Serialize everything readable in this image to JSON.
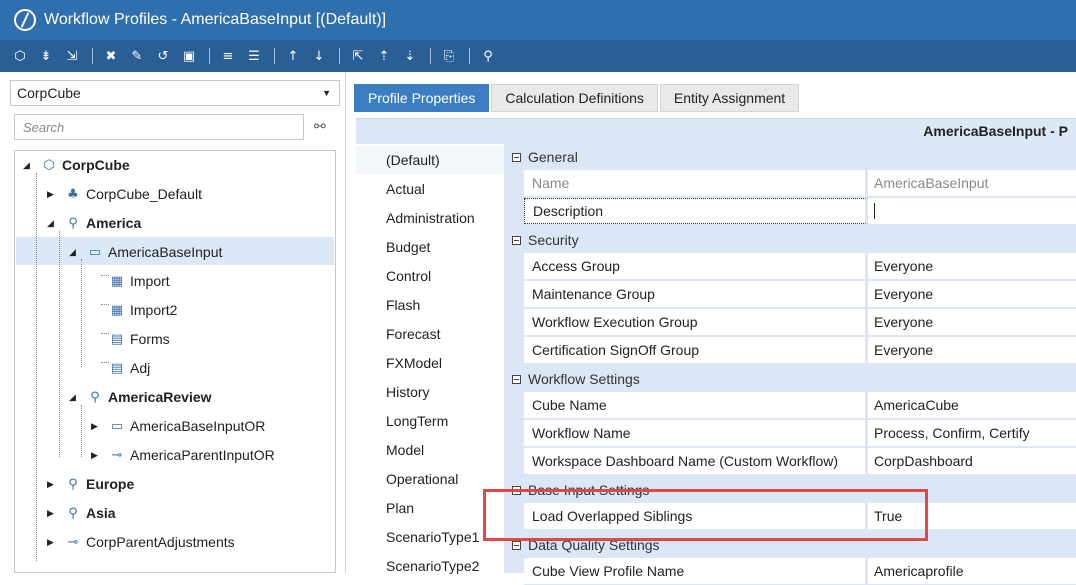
{
  "window": {
    "title": "Workflow Profiles - AmericaBaseInput [(Default)]"
  },
  "toolbar": {
    "icons": [
      "cube-icon",
      "add-sibling-icon",
      "add-child-icon",
      "delete-icon",
      "edit-icon",
      "refresh-icon",
      "save-icon",
      "collapse-icon",
      "expand-icon",
      "move-up-icon",
      "move-down-icon",
      "promote-icon",
      "add-up-icon",
      "demote-icon",
      "copy-icon",
      "search-icon"
    ]
  },
  "left": {
    "cube_select": "CorpCube",
    "search_placeholder": "Search",
    "tree": [
      {
        "label": "CorpCube",
        "bold": true
      },
      {
        "label": "CorpCube_Default",
        "bold": false
      },
      {
        "label": "America",
        "bold": true
      },
      {
        "label": "AmericaBaseInput",
        "bold": false
      },
      {
        "label": "Import",
        "bold": false
      },
      {
        "label": "Import2",
        "bold": false
      },
      {
        "label": "Forms",
        "bold": false
      },
      {
        "label": "Adj",
        "bold": false
      },
      {
        "label": "AmericaReview",
        "bold": true
      },
      {
        "label": "AmericaBaseInputOR",
        "bold": false
      },
      {
        "label": "AmericaParentInputOR",
        "bold": false
      },
      {
        "label": "Europe",
        "bold": true
      },
      {
        "label": "Asia",
        "bold": true
      },
      {
        "label": "CorpParentAdjustments",
        "bold": false
      }
    ]
  },
  "tabs": [
    "Profile Properties",
    "Calculation Definitions",
    "Entity Assignment"
  ],
  "header": {
    "title": "AmericaBaseInput - P"
  },
  "scenario_types": [
    "(Default)",
    "Actual",
    "Administration",
    "Budget",
    "Control",
    "Flash",
    "Forecast",
    "FXModel",
    "History",
    "LongTerm",
    "Model",
    "Operational",
    "Plan",
    "ScenarioType1",
    "ScenarioType2"
  ],
  "properties": {
    "general": {
      "title": "General",
      "name_label": "Name",
      "name_value": "AmericaBaseInput",
      "description_label": "Description"
    },
    "security": {
      "title": "Security",
      "rows": [
        {
          "k": "Access Group",
          "v": "Everyone"
        },
        {
          "k": "Maintenance Group",
          "v": "Everyone"
        },
        {
          "k": "Workflow Execution Group",
          "v": "Everyone"
        },
        {
          "k": "Certification SignOff Group",
          "v": "Everyone"
        }
      ]
    },
    "workflow": {
      "title": "Workflow Settings",
      "rows": [
        {
          "k": "Cube Name",
          "v": "AmericaCube"
        },
        {
          "k": "Workflow Name",
          "v": "Process, Confirm, Certify"
        },
        {
          "k": "Workspace Dashboard Name (Custom Workflow)",
          "v": "CorpDashboard"
        }
      ]
    },
    "base_input": {
      "title": "Base Input Settings",
      "rows": [
        {
          "k": "Load Overlapped Siblings",
          "v": "True"
        }
      ]
    },
    "data_quality": {
      "title": "Data Quality Settings",
      "rows": [
        {
          "k": "Cube View Profile Name",
          "v": "Americaprofile"
        }
      ]
    }
  },
  "colors": {
    "title_bar": "#2f6fae",
    "toolbar": "#2a5f96",
    "active_tab": "#3d7dc1",
    "grid_bg": "#dbe7f4",
    "highlight": "#e04848"
  }
}
